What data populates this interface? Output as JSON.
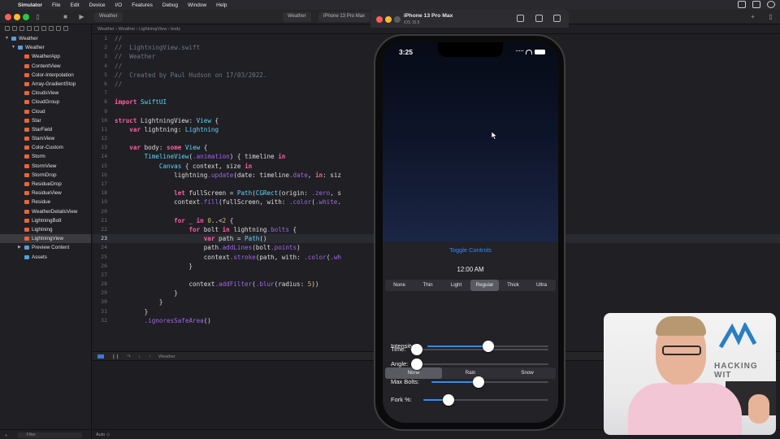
{
  "menubar": {
    "app_name": "Simulator",
    "items": [
      "File",
      "Edit",
      "Device",
      "I/O",
      "Features",
      "Debug",
      "Window",
      "Help"
    ]
  },
  "xcode": {
    "tab_title": "Weather",
    "scheme_tab": "Weather",
    "destination_tab": "iPhone 13 Pro Max",
    "jumpbar": "Weather  ›  Weather  ›  LightningView  ›  body",
    "debug_target": "Weather",
    "console_mode": "Auto ◇",
    "filter_placeholder": "Filter"
  },
  "navigator": {
    "items": [
      {
        "label": "Weather",
        "kind": "project"
      },
      {
        "label": "Weather",
        "kind": "folder"
      },
      {
        "label": "WeatherApp",
        "kind": "swift"
      },
      {
        "label": "ContentView",
        "kind": "swift"
      },
      {
        "label": "Color-Interpolation",
        "kind": "swift"
      },
      {
        "label": "Array-GradientStop",
        "kind": "swift"
      },
      {
        "label": "CloudsView",
        "kind": "swift"
      },
      {
        "label": "CloudGroup",
        "kind": "swift"
      },
      {
        "label": "Cloud",
        "kind": "swift"
      },
      {
        "label": "Star",
        "kind": "swift"
      },
      {
        "label": "StarField",
        "kind": "swift"
      },
      {
        "label": "StarsView",
        "kind": "swift"
      },
      {
        "label": "Color-Custom",
        "kind": "swift"
      },
      {
        "label": "Storm",
        "kind": "swift"
      },
      {
        "label": "StormView",
        "kind": "swift"
      },
      {
        "label": "StormDrop",
        "kind": "swift"
      },
      {
        "label": "ResidueDrop",
        "kind": "swift"
      },
      {
        "label": "ResidueView",
        "kind": "swift"
      },
      {
        "label": "Residue",
        "kind": "swift"
      },
      {
        "label": "WeatherDetailsView",
        "kind": "swift"
      },
      {
        "label": "LightningBolt",
        "kind": "swift"
      },
      {
        "label": "Lightning",
        "kind": "swift"
      },
      {
        "label": "LightningView",
        "kind": "swift"
      },
      {
        "label": "Preview Content",
        "kind": "folder"
      },
      {
        "label": "Assets",
        "kind": "assets"
      }
    ]
  },
  "code": {
    "current_line": 23,
    "lines": [
      {
        "n": "1",
        "text": "//"
      },
      {
        "n": "2",
        "text": "//  LightningView.swift"
      },
      {
        "n": "3",
        "text": "//  Weather"
      },
      {
        "n": "4",
        "text": "//"
      },
      {
        "n": "5",
        "text": "//  Created by Paul Hudson on 17/03/2022."
      },
      {
        "n": "6",
        "text": "//"
      },
      {
        "n": "7",
        "text": ""
      },
      {
        "n": "8",
        "text": "import SwiftUI"
      },
      {
        "n": "9",
        "text": ""
      },
      {
        "n": "10",
        "text": "struct LightningView: View {"
      },
      {
        "n": "11",
        "text": "    var lightning: Lightning"
      },
      {
        "n": "12",
        "text": ""
      },
      {
        "n": "13",
        "text": "    var body: some View {"
      },
      {
        "n": "14",
        "text": "        TimelineView(.animation) { timeline in"
      },
      {
        "n": "15",
        "text": "            Canvas { context, size in"
      },
      {
        "n": "16",
        "text": "                lightning.update(date: timeline.date, in: siz"
      },
      {
        "n": "17",
        "text": ""
      },
      {
        "n": "18",
        "text": "                let fullScreen = Path(CGRect(origin: .zero, s"
      },
      {
        "n": "19",
        "text": "                context.fill(fullScreen, with: .color(.white."
      },
      {
        "n": "20",
        "text": ""
      },
      {
        "n": "21",
        "text": "                for _ in 0..<2 {"
      },
      {
        "n": "22",
        "text": "                    for bolt in lightning.bolts {"
      },
      {
        "n": "23",
        "text": "                        var path = Path()"
      },
      {
        "n": "24",
        "text": "                        path.addLines(bolt.points)"
      },
      {
        "n": "25",
        "text": "                        context.stroke(path, with: .color(.wh"
      },
      {
        "n": "26",
        "text": "                    }"
      },
      {
        "n": "27",
        "text": ""
      },
      {
        "n": "28",
        "text": "                    context.addFilter(.blur(radius: 5))"
      },
      {
        "n": "29",
        "text": "                }"
      },
      {
        "n": "30",
        "text": "            }"
      },
      {
        "n": "31",
        "text": "        }"
      },
      {
        "n": "32",
        "text": "        .ignoresSafeArea()"
      }
    ]
  },
  "simulator": {
    "device_name": "iPhone 13 Pro Max",
    "os_version": "iOS 15.5",
    "status_time": "3:25"
  },
  "app": {
    "toggle_controls": "Toggle Controls",
    "time_display": "12:00 AM",
    "thickness": {
      "options": [
        "None",
        "Thin",
        "Light",
        "Regular",
        "Thick",
        "Ultra"
      ],
      "selected": "Regular"
    },
    "precipitation": {
      "options": [
        "None",
        "Rain",
        "Snow"
      ],
      "selected": "None"
    },
    "sliders": [
      {
        "key": "time",
        "label": "Time:",
        "value": 0.0
      },
      {
        "key": "intensity",
        "label": "Intensity:",
        "value": 0.5
      },
      {
        "key": "angle",
        "label": "Angle:",
        "value": 0.0
      },
      {
        "key": "max_bolts",
        "label": "Max Bolts:",
        "value": 0.4
      },
      {
        "key": "fork",
        "label": "Fork %:",
        "value": 0.2
      }
    ],
    "accent_color": "#2f8cff"
  },
  "webcam": {
    "sign_text": "HACKING WIT"
  }
}
